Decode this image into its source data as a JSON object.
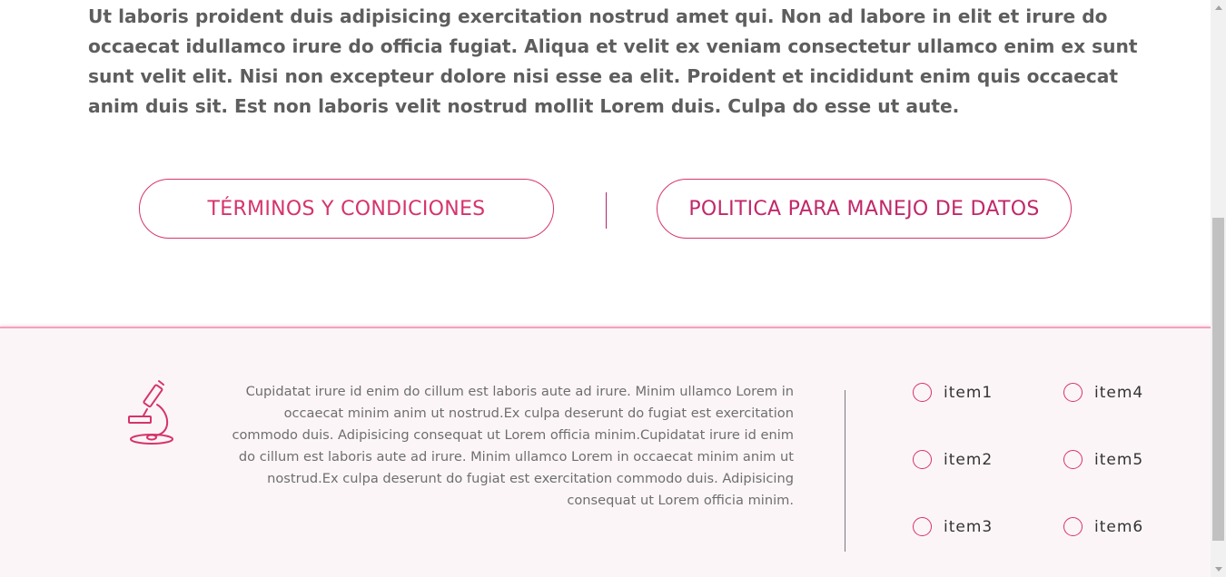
{
  "intro": {
    "text": "Ut laboris proident duis adipisicing exercitation nostrud amet qui. Non ad labore in elit et irure do occaecat idullamco irure do officia fugiat. Aliqua et velit ex veniam consectetur ullamco enim ex sunt sunt velit elit. Nisi non excepteur dolore nisi esse ea elit. Proident et incididunt enim quis occaecat anim duis sit. Est non laboris velit nostrud mollit Lorem duis. Culpa do esse ut aute."
  },
  "buttons": {
    "terms_label": "TÉRMINOS Y CONDICIONES",
    "policy_label": "POLITICA PARA MANEJO DE DATOS"
  },
  "footer": {
    "icon": "microscope-icon",
    "text": "Cupidatat irure id enim do cillum est laboris aute ad irure. Minim ullamco Lorem in occaecat minim anim ut nostrud.Ex culpa deserunt do fugiat est exercitation commodo duis. Adipisicing consequat ut Lorem officia minim.Cupidatat irure id enim do cillum est laboris aute ad irure. Minim ullamco Lorem in occaecat minim anim ut nostrud.Ex culpa deserunt do fugiat est exercitation commodo duis. Adipisicing consequat ut Lorem officia minim.",
    "options": [
      {
        "label": "item1"
      },
      {
        "label": "item2"
      },
      {
        "label": "item3"
      },
      {
        "label": "item4"
      },
      {
        "label": "item5"
      },
      {
        "label": "item6"
      }
    ]
  },
  "colors": {
    "accent": "#d6336c",
    "body_text": "#5e5e5e",
    "footer_bg": "#fcf5f7"
  }
}
